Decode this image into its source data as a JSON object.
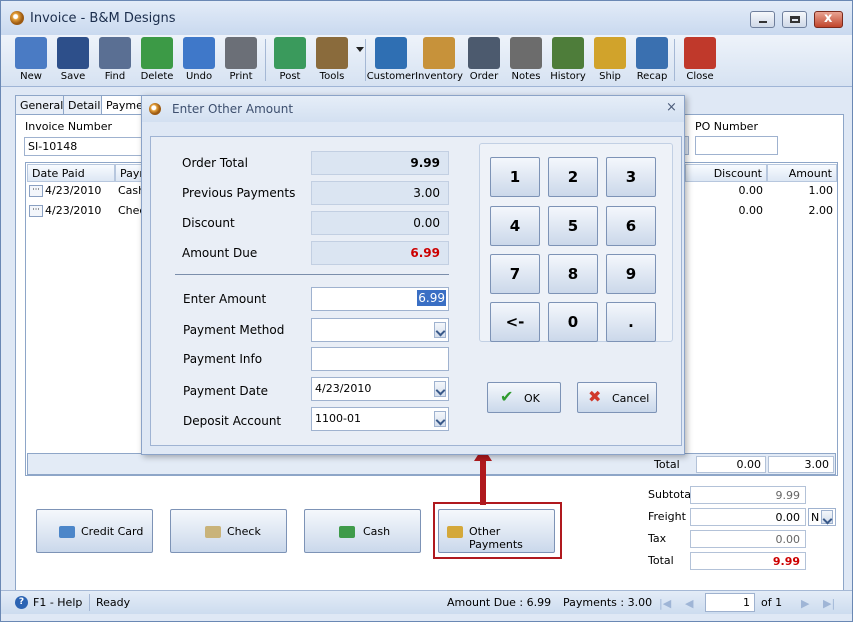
{
  "window": {
    "title": "Invoice - B&M Designs"
  },
  "toolbar": [
    {
      "label": "New",
      "icon": "new-document-icon",
      "color": "#4a7bc4"
    },
    {
      "label": "Save",
      "icon": "floppy-disk-icon",
      "color": "#2d4f8a"
    },
    {
      "label": "Find",
      "icon": "binoculars-icon",
      "color": "#5a6f93"
    },
    {
      "label": "Delete",
      "icon": "recycle-bin-icon",
      "color": "#3c9a46"
    },
    {
      "label": "Undo",
      "icon": "undo-arrow-icon",
      "color": "#3f78c9"
    },
    {
      "label": "Print",
      "icon": "printer-icon",
      "color": "#6b6f77"
    },
    {
      "label": "Post",
      "icon": "post-checklist-icon",
      "color": "#3a9a5c"
    },
    {
      "label": "Tools",
      "icon": "tools-icon",
      "color": "#8a6b3c"
    },
    {
      "label": "Customer",
      "icon": "customer-person-icon",
      "color": "#2f6fb3"
    },
    {
      "label": "Inventory",
      "icon": "boxes-icon",
      "color": "#c7923a"
    },
    {
      "label": "Order",
      "icon": "handheld-order-icon",
      "color": "#4c5a6e"
    },
    {
      "label": "Notes",
      "icon": "notepad-pen-icon",
      "color": "#6c6c6c"
    },
    {
      "label": "History",
      "icon": "history-person-icon",
      "color": "#4e7d3a"
    },
    {
      "label": "Ship",
      "icon": "forklift-icon",
      "color": "#d1a32b"
    },
    {
      "label": "Recap",
      "icon": "recap-sheet-icon",
      "color": "#3a70b0"
    },
    {
      "label": "Close",
      "icon": "close-window-icon",
      "color": "#c0392b"
    }
  ],
  "tabs": [
    "General",
    "Detail",
    "Payments"
  ],
  "form": {
    "invoice_number_label": "Invoice Number",
    "invoice_number": "SI-10148",
    "po_number_label": "PO Number",
    "po_number": ""
  },
  "grid": {
    "columns": [
      "Date Paid",
      "Paym",
      "Discount",
      "Amount"
    ],
    "rows": [
      {
        "date": "4/23/2010",
        "method": "Cash",
        "discount": "0.00",
        "amount": "1.00"
      },
      {
        "date": "4/23/2010",
        "method": "Chec",
        "discount": "0.00",
        "amount": "2.00"
      }
    ],
    "row_button": "···",
    "total_label": "Total",
    "total_discount": "0.00",
    "total_amount": "3.00"
  },
  "payment_buttons": {
    "credit_card": "Credit Card",
    "check": "Check",
    "cash": "Cash",
    "other": "Other Payments"
  },
  "summary": {
    "subtotal_label": "Subtotal",
    "subtotal": "9.99",
    "freight_label": "Freight",
    "freight": "0.00",
    "freight_code": "N",
    "tax_label": "Tax",
    "tax": "0.00",
    "total_label": "Total",
    "total": "9.99"
  },
  "status": {
    "help": "F1 - Help",
    "ready": "Ready",
    "amount_due": "Amount Due : 6.99",
    "payments": "Payments : 3.00",
    "page": "1",
    "of": "of 1"
  },
  "dialog": {
    "title": "Enter Other Amount",
    "order_total_label": "Order Total",
    "order_total": "9.99",
    "previous_payments_label": "Previous Payments",
    "previous_payments": "3.00",
    "discount_label": "Discount",
    "discount": "0.00",
    "amount_due_label": "Amount Due",
    "amount_due": "6.99",
    "enter_amount_label": "Enter Amount",
    "enter_amount": "6.99",
    "payment_method_label": "Payment Method",
    "payment_method": "",
    "payment_info_label": "Payment Info",
    "payment_info": "",
    "payment_date_label": "Payment Date",
    "payment_date": "4/23/2010",
    "deposit_account_label": "Deposit Account",
    "deposit_account": "1100-01",
    "keys": [
      "1",
      "2",
      "3",
      "4",
      "5",
      "6",
      "7",
      "8",
      "9",
      "<-",
      "0",
      "."
    ],
    "ok": "OK",
    "cancel": "Cancel"
  },
  "colors": {
    "amount_due_red": "#cc0000",
    "highlight_box": "#b0191e",
    "annotation_arrow": "#b0191e",
    "selection": "#3a6fc4"
  }
}
